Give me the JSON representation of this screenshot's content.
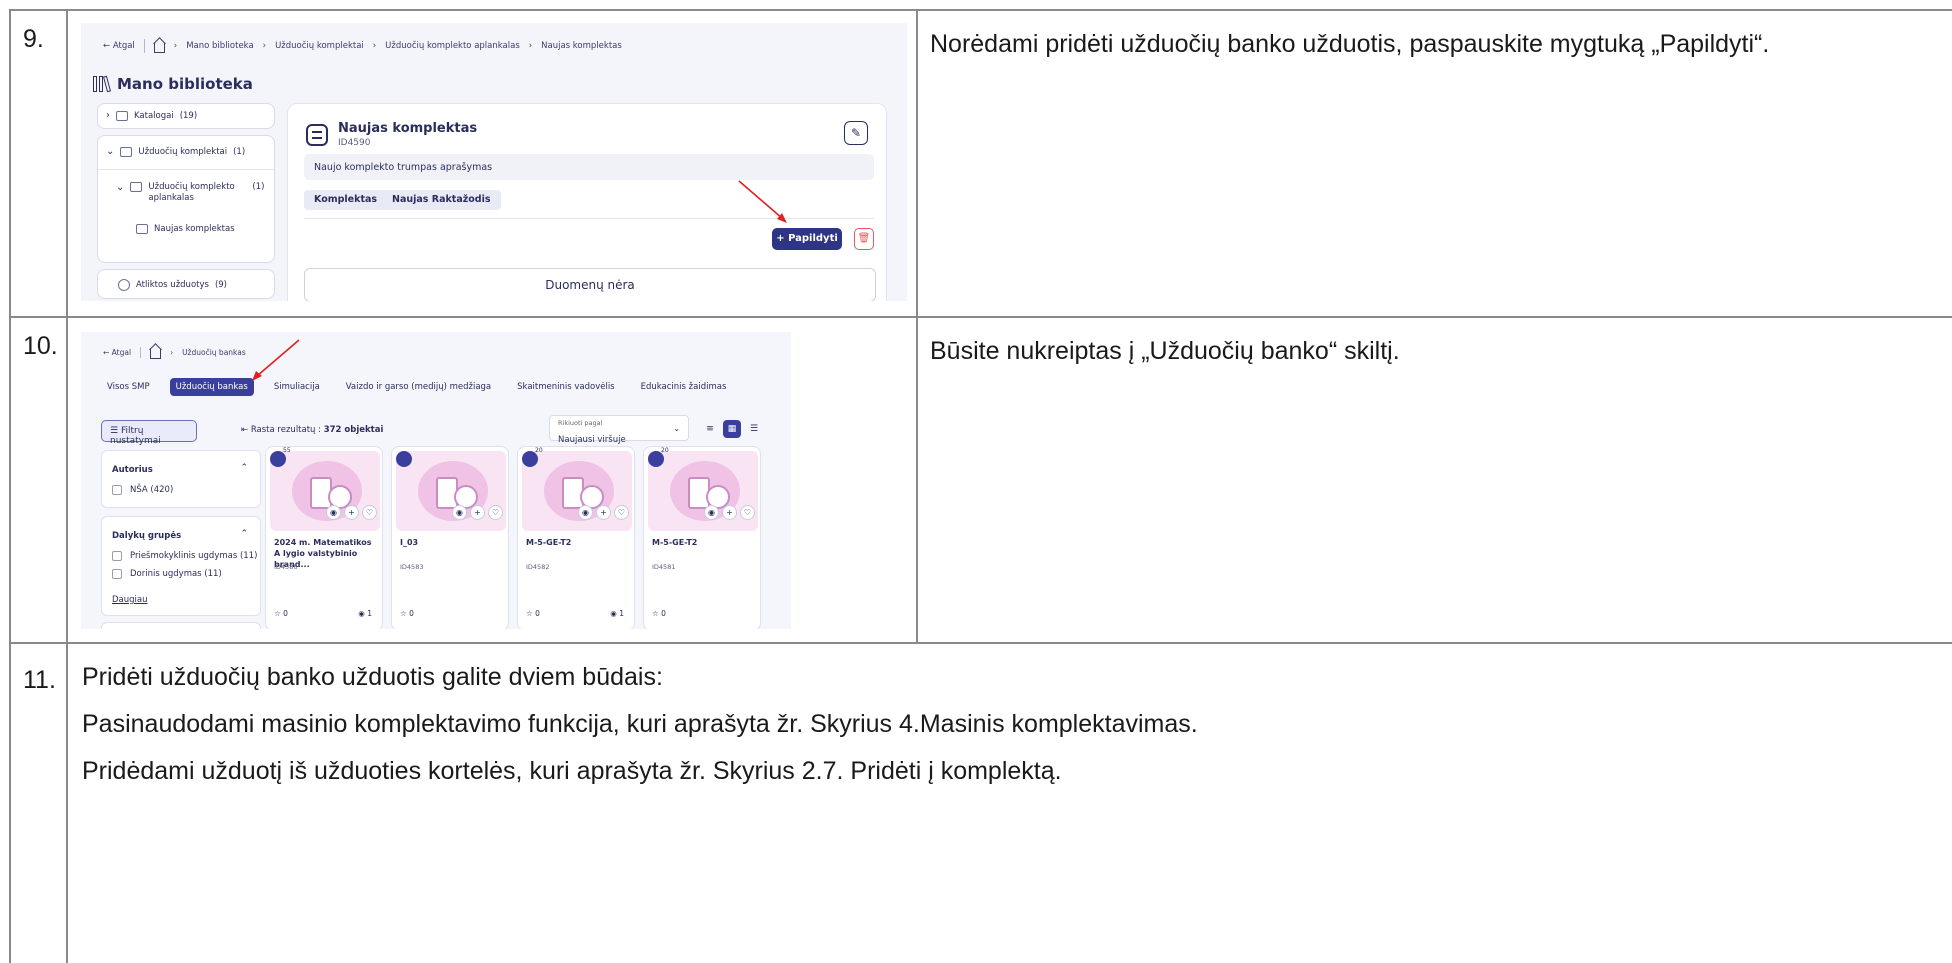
{
  "rows": [
    {
      "number": "9.",
      "description": "Norėdami pridėti užduočių banko užduotis, paspauskite mygtuką „Papildyti“.",
      "screenshot": {
        "breadcrumb": [
          "Atgal",
          "Mano biblioteka",
          "Užduočių komplektai",
          "Užduočių komplekto aplankalas",
          "Naujas komplektas"
        ],
        "page_title": "Mano biblioteka",
        "sidebar": {
          "catalogs": {
            "label": "Katalogai",
            "count": "(19)"
          },
          "task_sets": {
            "label": "Užduočių komplektai",
            "count": "(1)"
          },
          "folder": {
            "label": "Užduočių komplekto aplankalas",
            "count": "(1)"
          },
          "kit": "Naujas komplektas",
          "completed": {
            "label": "Atliktos užduotys",
            "count": "(9)"
          }
        },
        "kit": {
          "title": "Naujas komplektas",
          "id": "ID4590",
          "description": "Naujo komplekto trumpas aprašymas",
          "tags": [
            "Komplektas",
            "Naujas Raktažodis"
          ],
          "add_button": "+ Papildyti",
          "empty": "Duomenų nėra"
        }
      }
    },
    {
      "number": "10.",
      "description": "Būsite nukreiptas į „Užduočių banko“ skiltį.",
      "screenshot": {
        "breadcrumb": [
          "Atgal",
          "Užduočių bankas"
        ],
        "tabs": [
          "Visos SMP",
          "Užduočių bankas",
          "Simuliacija",
          "Vaizdo ir garso (medijų) medžiaga",
          "Skaitmeninis vadovėlis",
          "Edukacinis žaidimas"
        ],
        "active_tab": "Užduočių bankas",
        "filter_button": "Filtrų nustatymai",
        "results_label": "Rasta rezultatų :",
        "results_count": "372 objektai",
        "sort_label": "Rikiuoti pagal",
        "sort_value": "Naujausi viršuje",
        "filters": {
          "author": {
            "title": "Autorius",
            "options": [
              "NŠA (420)"
            ]
          },
          "subjects": {
            "title": "Dalykų grupės",
            "options": [
              "Priešmokyklinis ugdymas (11)",
              "Dorinis ugdymas (11)"
            ],
            "more": "Daugiau"
          }
        },
        "cards": [
          {
            "badge": "55",
            "title": "2024 m. Matematikos A lygio valstybinio brand...",
            "id": "ID4586",
            "stars": "0",
            "views": "1"
          },
          {
            "badge": "",
            "title": "I_03",
            "id": "ID4583",
            "stars": "0",
            "views": ""
          },
          {
            "badge": "20",
            "title": "M-5-GE-T2",
            "id": "ID4582",
            "stars": "0",
            "views": "1"
          },
          {
            "badge": "20",
            "title": "M-5-GE-T2",
            "id": "ID4581",
            "stars": "0",
            "views": ""
          }
        ],
        "accent_color": "#3a3f9e"
      }
    },
    {
      "number": "11.",
      "lines": [
        "Pridėti užduočių banko užduotis galite dviem būdais:",
        "Pasinaudodami masinio komplektavimo funkcija, kuri aprašyta žr. Skyrius 4.Masinis komplektavimas.",
        "Pridėdami užduotį iš užduoties kortelės, kuri aprašyta žr. Skyrius 2.7. Pridėti į komplektą."
      ]
    }
  ]
}
